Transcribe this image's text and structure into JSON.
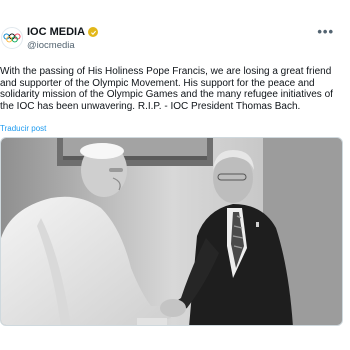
{
  "post": {
    "author_name": "IOC MEDIA",
    "handle": "@iocmedia",
    "menu_icon": "more-horizontal-icon",
    "verified_icon": "verified-badge-icon",
    "verified_color": "#e2b719",
    "body_lines": [
      "With the passing of His Holiness Pope Francis, we are losing a great friend",
      "and supporter of the Olympic Movement. His support for the peace and",
      "solidarity mission of the Olympic Games and the many refugee initiatives of",
      "the IOC has been unwavering. R.I.P. - IOC President Thomas Bach."
    ],
    "translate_label": "Traducir post",
    "link_color": "#1d9bf0",
    "photo_icon": "handshake-photo"
  }
}
